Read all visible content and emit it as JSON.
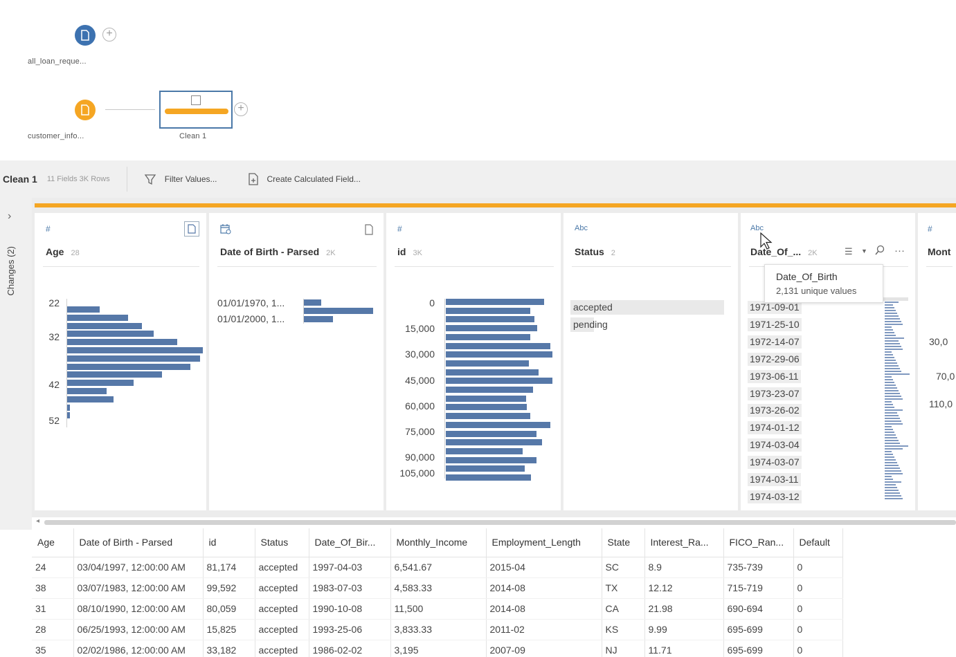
{
  "flow": {
    "nodes": [
      {
        "label": "all_loan_reque...",
        "color": "#3d72b0"
      },
      {
        "label": "customer_info...",
        "color": "#f5a623"
      }
    ],
    "clean_node_label": "Clean 1"
  },
  "toolbar": {
    "title": "Clean 1",
    "meta": "11 Fields  3K Rows",
    "filter_label": "Filter Values...",
    "calc_label": "Create Calculated Field..."
  },
  "rail": {
    "changes_label": "Changes (2)"
  },
  "profile": {
    "cards": [
      {
        "type": "#",
        "name": "Age",
        "count": "28"
      },
      {
        "type": "date",
        "name": "Date of Birth - Parsed",
        "count": "2K"
      },
      {
        "type": "#",
        "name": "id",
        "count": "3K"
      },
      {
        "type": "Abc",
        "name": "Status",
        "count": "2"
      },
      {
        "type": "Abc",
        "name": "Date_Of_...",
        "count": "2K"
      },
      {
        "type": "#",
        "name": "Mont"
      }
    ],
    "age": {
      "ticks": [
        "22",
        "32",
        "42",
        "52"
      ],
      "bars": [
        0.24,
        0.45,
        0.55,
        0.64,
        0.81,
        1.0,
        0.98,
        0.91,
        0.7,
        0.49,
        0.29,
        0.34,
        0.02,
        0.02
      ]
    },
    "dob_parsed": {
      "labels": [
        "01/01/1970, 1...",
        "01/01/2000, 1..."
      ],
      "bars": [
        0.25,
        1.0,
        0.42
      ]
    },
    "id": {
      "ticks": [
        "0",
        "15,000",
        "30,000",
        "45,000",
        "60,000",
        "75,000",
        "90,000",
        "105,000"
      ],
      "bars": [
        0.92,
        0.79,
        0.83,
        0.86,
        0.79,
        0.98,
        1.0,
        0.78,
        0.87,
        1.0,
        0.82,
        0.75,
        0.76,
        0.79,
        0.98,
        0.85,
        0.9,
        0.72,
        0.85,
        0.74,
        0.8
      ]
    },
    "status": {
      "values": [
        "accepted",
        "pending"
      ]
    },
    "dob": {
      "values": [
        "1971-09-01",
        "1971-25-10",
        "1972-14-07",
        "1972-29-06",
        "1973-06-11",
        "1973-23-07",
        "1973-26-02",
        "1974-01-12",
        "1974-03-04",
        "1974-03-07",
        "1974-03-11",
        "1974-03-12"
      ]
    },
    "month": {
      "ticks": [
        "30,0",
        "70,0",
        "110,0"
      ]
    },
    "tooltip": {
      "title": "Date_Of_Birth",
      "subtitle": "2,131 unique values"
    }
  },
  "grid": {
    "columns": [
      "Age",
      "Date of Birth - Parsed",
      "id",
      "Status",
      "Date_Of_Bir...",
      "Monthly_Income",
      "Employment_Length",
      "State",
      "Interest_Ra...",
      "FICO_Ran...",
      "Default"
    ],
    "rows": [
      [
        "24",
        "03/04/1997, 12:00:00 AM",
        "81,174",
        "accepted",
        "1997-04-03",
        "6,541.67",
        "2015-04",
        "SC",
        "8.9",
        "735-739",
        "0"
      ],
      [
        "38",
        "03/07/1983, 12:00:00 AM",
        "99,592",
        "accepted",
        "1983-07-03",
        "4,583.33",
        "2014-08",
        "TX",
        "12.12",
        "715-719",
        "0"
      ],
      [
        "31",
        "08/10/1990, 12:00:00 AM",
        "80,059",
        "accepted",
        "1990-10-08",
        "11,500",
        "2014-08",
        "CA",
        "21.98",
        "690-694",
        "0"
      ],
      [
        "28",
        "06/25/1993, 12:00:00 AM",
        "15,825",
        "accepted",
        "1993-25-06",
        "3,833.33",
        "2011-02",
        "KS",
        "9.99",
        "695-699",
        "0"
      ],
      [
        "35",
        "02/02/1986, 12:00:00 AM",
        "33,182",
        "accepted",
        "1986-02-02",
        "3,195",
        "2007-09",
        "NJ",
        "11.71",
        "695-699",
        "0"
      ]
    ]
  }
}
